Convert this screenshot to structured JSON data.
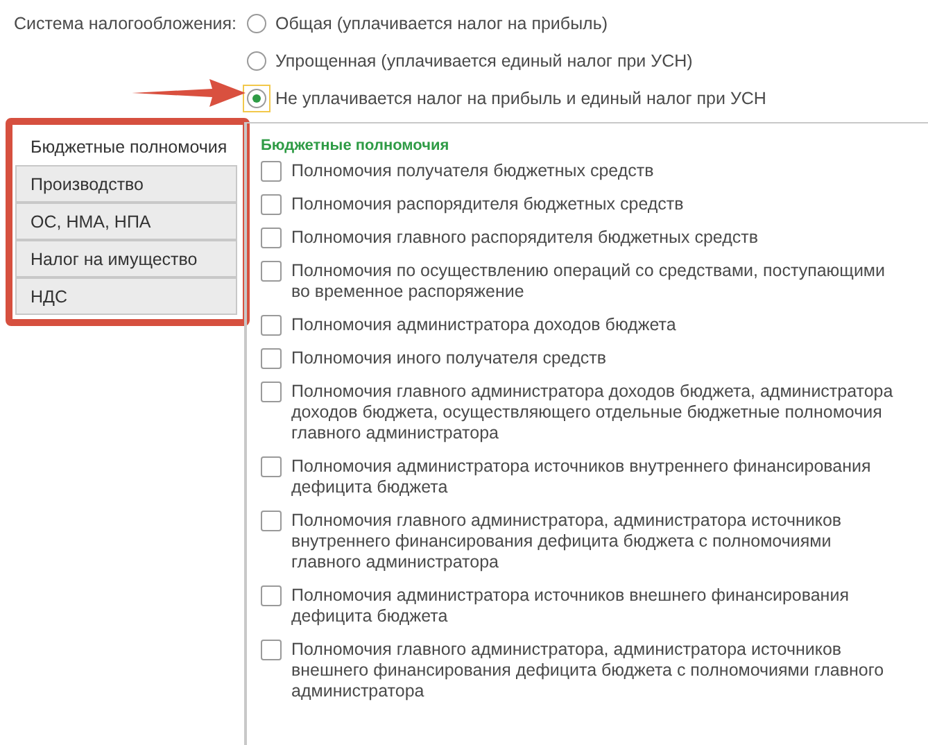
{
  "tax_system": {
    "label": "Система налогообложения:",
    "options": [
      {
        "label": "Общая (уплачивается налог на прибыль)",
        "selected": false
      },
      {
        "label": "Упрощенная (уплачивается единый налог при УСН)",
        "selected": false
      },
      {
        "label": "Не уплачивается налог на прибыль и единый налог при УСН",
        "selected": true
      }
    ]
  },
  "tabs": [
    {
      "label": "Бюджетные полномочия",
      "selected": true
    },
    {
      "label": "Производство",
      "selected": false
    },
    {
      "label": "ОС, НМА, НПА",
      "selected": false
    },
    {
      "label": "Налог на имущество",
      "selected": false
    },
    {
      "label": "НДС",
      "selected": false
    }
  ],
  "section": {
    "title": "Бюджетные полномочия",
    "items": [
      {
        "label": "Полномочия получателя бюджетных средств",
        "checked": false
      },
      {
        "label": "Полномочия распорядителя бюджетных средств",
        "checked": false
      },
      {
        "label": "Полномочия главного распорядителя бюджетных средств",
        "checked": false
      },
      {
        "label": "Полномочия по осуществлению операций со средствами, поступающими во временное распоряжение",
        "checked": false
      },
      {
        "label": "Полномочия администратора доходов бюджета",
        "checked": false
      },
      {
        "label": "Полномочия иного получателя средств",
        "checked": false
      },
      {
        "label": "Полномочия главного администратора доходов бюджета, администратора доходов бюджета, осуществляющего отдельные бюджетные полномочия главного администратора",
        "checked": false
      },
      {
        "label": "Полномочия администратора источников внутреннего финансирования дефицита бюджета",
        "checked": false
      },
      {
        "label": "Полномочия главного администратора, администратора источников внутреннего финансирования дефицита бюджета с полномочиями главного администратора",
        "checked": false
      },
      {
        "label": "Полномочия администратора источников внешнего финансирования дефицита бюджета",
        "checked": false
      },
      {
        "label": "Полномочия главного администратора, администратора источников внешнего финансирования дефицита бюджета с полномочиями главного администратора",
        "checked": false
      }
    ]
  }
}
